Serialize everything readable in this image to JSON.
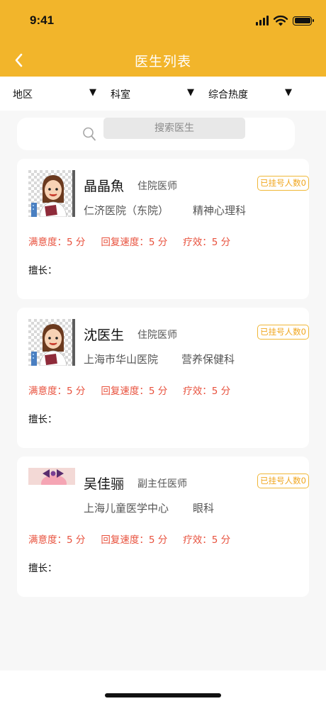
{
  "status_bar": {
    "time": "9:41"
  },
  "nav": {
    "title": "医生列表"
  },
  "filters": [
    {
      "label": "地区",
      "arrow": "▼"
    },
    {
      "label": "科室",
      "arrow": "▼"
    },
    {
      "label": "综合热度",
      "arrow": "▼"
    }
  ],
  "search": {
    "placeholder": "搜索医生"
  },
  "doctors": [
    {
      "name": "晶晶魚",
      "title": "住院医师",
      "hospital": "仁济医院（东院）",
      "department": "精神心理科",
      "registered_badge": "已挂号人数0",
      "satisfaction": "满意度：5 分",
      "reply_speed": "回复速度：5 分",
      "efficacy": "疗效：5 分",
      "specialty": "擅长："
    },
    {
      "name": "沈医生",
      "title": "住院医师",
      "hospital": "上海市华山医院",
      "department": "营养保健科",
      "registered_badge": "已挂号人数0",
      "satisfaction": "满意度：5 分",
      "reply_speed": "回复速度：5 分",
      "efficacy": "疗效：5 分",
      "specialty": "擅长："
    },
    {
      "name": "吴佳骊",
      "title": "副主任医师",
      "hospital": "上海儿童医学中心",
      "department": "眼科",
      "registered_badge": "已挂号人数0",
      "satisfaction": "满意度：5 分",
      "reply_speed": "回复速度：5 分",
      "efficacy": "疗效：5 分",
      "specialty": "擅长："
    }
  ],
  "colors": {
    "header": "#f2b52b",
    "rating_text": "#e8513d",
    "badge": "#f0a51c"
  },
  "icons": [
    "back-arrow-icon",
    "search-icon",
    "signal-icon",
    "wifi-icon",
    "battery-icon",
    "dropdown-arrow-icon"
  ]
}
